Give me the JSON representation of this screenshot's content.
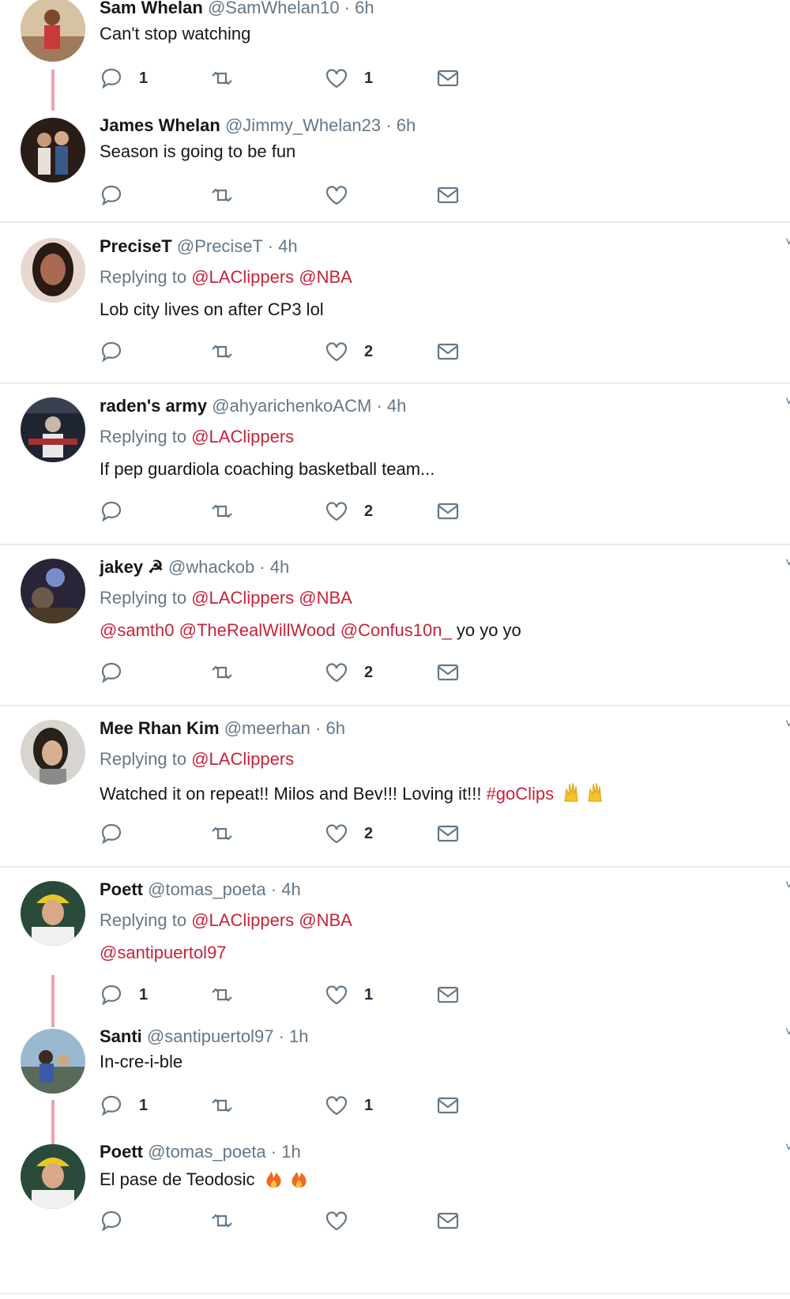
{
  "tweets": [
    {
      "name": "Sam Whelan",
      "handle": "@SamWhelan10",
      "time": "· 6h",
      "reply_prefix": "",
      "reply_mentions": [],
      "text_mentions": [],
      "text": "Can't stop watching",
      "emojis": "",
      "counts": {
        "reply": "1",
        "like": "1"
      },
      "avatar_color": "#c9a07a"
    },
    {
      "name": "James Whelan",
      "handle": "@Jimmy_Whelan23",
      "time": "· 6h",
      "reply_prefix": "",
      "reply_mentions": [],
      "text_mentions": [],
      "text": "Season is going to be fun",
      "emojis": "",
      "counts": {
        "reply": "",
        "like": ""
      },
      "avatar_color": "#3d2a22"
    },
    {
      "name": "PreciseT",
      "handle": "@PreciseT",
      "time": "· 4h",
      "reply_prefix": "Replying to",
      "reply_mentions": [
        "@LAClippers",
        "@NBA"
      ],
      "text_mentions": [],
      "text": "Lob city lives on after CP3 lol",
      "emojis": "",
      "counts": {
        "reply": "",
        "like": "2"
      },
      "avatar_color": "#8a5a45"
    },
    {
      "name": "raden's army",
      "handle": "@ahyarichenkoACM",
      "time": "· 4h",
      "reply_prefix": "Replying to",
      "reply_mentions": [
        "@LAClippers"
      ],
      "text_mentions": [],
      "text": "If pep guardiola coaching basketball team...",
      "emojis": "",
      "counts": {
        "reply": "",
        "like": "2"
      },
      "avatar_color": "#2a2f3a"
    },
    {
      "name": "jakey ☭",
      "handle": "@whackob",
      "time": "· 4h",
      "reply_prefix": "Replying to",
      "reply_mentions": [
        "@LAClippers",
        "@NBA"
      ],
      "text_mentions": [
        "@samth0",
        "@TheRealWillWood",
        "@Confus10n_"
      ],
      "text": "yo yo yo",
      "emojis": "",
      "counts": {
        "reply": "",
        "like": "2"
      },
      "avatar_color": "#4a3d5c"
    },
    {
      "name": "Mee Rhan Kim",
      "handle": "@meerhan",
      "time": "· 6h",
      "reply_prefix": "Replying to",
      "reply_mentions": [
        "@LAClippers"
      ],
      "text_mentions": [],
      "text": "Watched it on repeat!! Milos and Bev!!! Loving it!!!",
      "hashtag": "#goClips",
      "emojis": "🙌🙌",
      "counts": {
        "reply": "",
        "like": "2"
      },
      "avatar_color": "#5a4a40"
    },
    {
      "name": "Poett",
      "handle": "@tomas_poeta",
      "time": "· 4h",
      "reply_prefix": "Replying to",
      "reply_mentions": [
        "@LAClippers",
        "@NBA"
      ],
      "text_mentions": [
        "@santipuertol97"
      ],
      "text": "",
      "emojis": "",
      "counts": {
        "reply": "1",
        "like": "1"
      },
      "avatar_color": "#3a6a4a"
    },
    {
      "name": "Santi",
      "handle": "@santipuertol97",
      "time": "· 1h",
      "reply_prefix": "",
      "reply_mentions": [],
      "text_mentions": [],
      "text": "In-cre-i-ble",
      "emojis": "",
      "counts": {
        "reply": "1",
        "like": "1"
      },
      "avatar_color": "#6a8aa8"
    },
    {
      "name": "Poett",
      "handle": "@tomas_poeta",
      "time": "· 1h",
      "reply_prefix": "",
      "reply_mentions": [],
      "text_mentions": [],
      "text": "El pase de Teodosic",
      "emojis": "🔥🔥",
      "counts": {
        "reply": "",
        "like": ""
      },
      "avatar_color": "#3a6a4a"
    }
  ],
  "colors": {
    "accent": "#c4233b",
    "thread": "#e8a5ad",
    "muted": "#657786"
  },
  "icons": [
    "reply-icon",
    "retweet-icon",
    "like-icon",
    "direct-message-icon",
    "caret-down-icon"
  ]
}
